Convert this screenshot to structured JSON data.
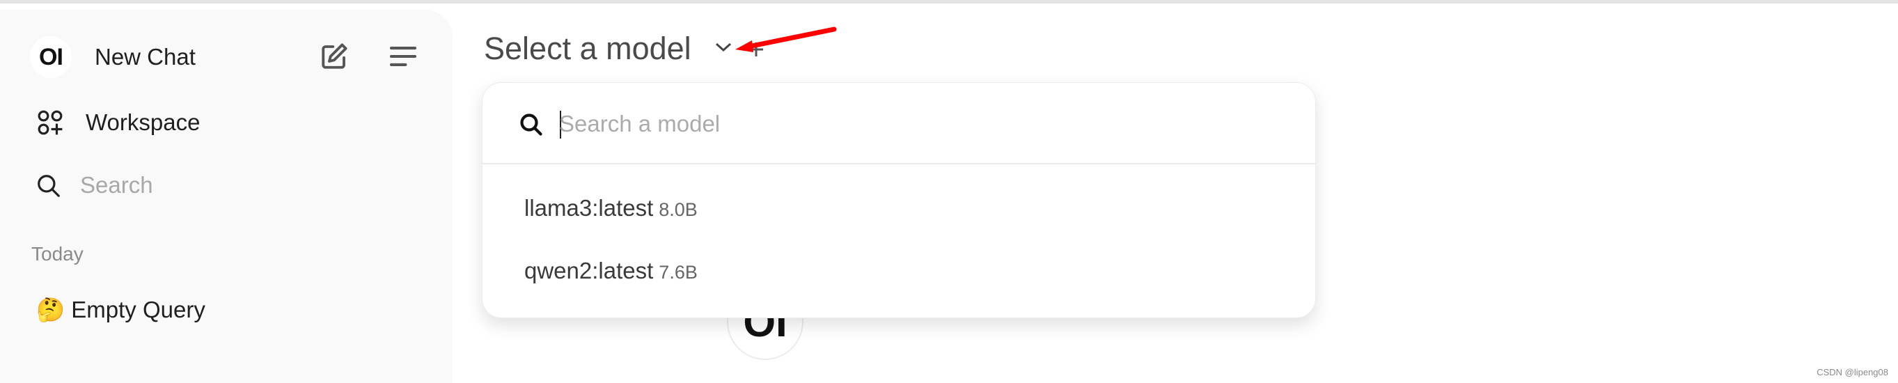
{
  "sidebar": {
    "logo_text": "OI",
    "new_chat": "New Chat",
    "workspace": "Workspace",
    "search_placeholder": "Search",
    "section_today": "Today",
    "chats": [
      {
        "emoji": "🤔",
        "title": "Empty Query"
      }
    ]
  },
  "header": {
    "model_selector": "Select a model"
  },
  "dropdown": {
    "search_placeholder": "Search a model",
    "models": [
      {
        "name": "llama3:latest",
        "size": "8.0B"
      },
      {
        "name": "qwen2:latest",
        "size": "7.6B"
      }
    ]
  },
  "main": {
    "logo_text": "OI"
  },
  "annotation": {
    "arrow_color": "#ff0000"
  },
  "watermark": "CSDN @lipeng08"
}
